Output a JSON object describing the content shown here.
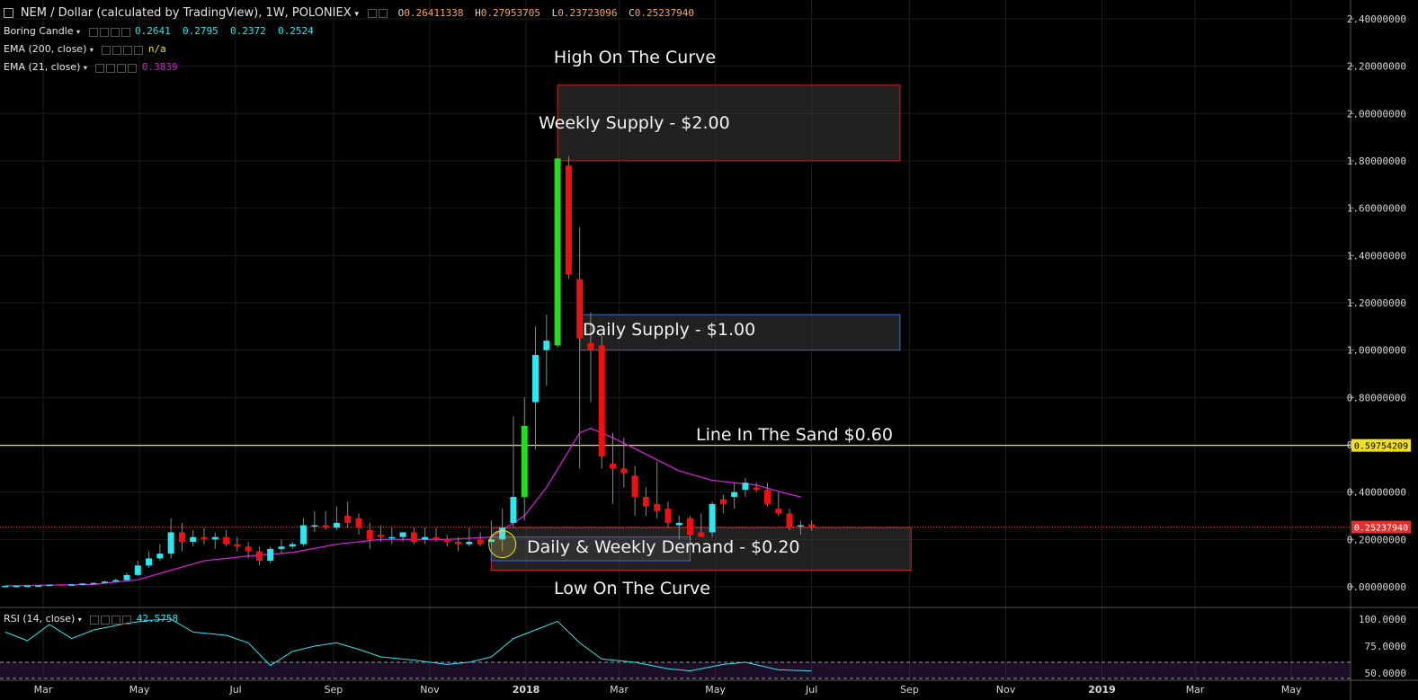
{
  "header": {
    "symbol_title": "NEM / Dollar (calculated by TradingView), 1W, POLONIEX",
    "ohlc": [
      {
        "label": "O",
        "value": "0.26411338"
      },
      {
        "label": "H",
        "value": "0.27953705"
      },
      {
        "label": "L",
        "value": "0.23723096"
      },
      {
        "label": "C",
        "value": "0.25237940"
      }
    ],
    "indicators": [
      {
        "name": "Boring Candle",
        "values": [
          "0.2641",
          "0.2795",
          "0.2372",
          "0.2524"
        ],
        "color": "#2ee6f0"
      },
      {
        "name": "EMA (200, close)",
        "values": [
          "n/a"
        ],
        "color": "#f0e020"
      },
      {
        "name": "EMA (21, close)",
        "values": [
          "0.3839"
        ],
        "color": "#d020d0"
      }
    ]
  },
  "rsi_header": {
    "name": "RSI (14, close)",
    "value": "42.5758",
    "color": "#2ee6f0"
  },
  "colors": {
    "bull_big": "#22dd22",
    "bull_small": "#2ee6f0",
    "bear": "#ee1111",
    "ema": "#d020d0",
    "rsi": "#2ee6f0",
    "level": "#f0e020",
    "price_line": "#e03030",
    "grid": "#1c1c1c"
  },
  "chart_data": {
    "type": "candlestick",
    "time_axis_labels": [
      "Mar",
      "May",
      "Jul",
      "Sep",
      "Nov",
      "2018",
      "Mar",
      "May",
      "Jul",
      "Sep",
      "Nov",
      "2019",
      "Mar",
      "May"
    ],
    "y_ticks": [
      "2.40000000",
      "2.20000000",
      "2.00000000",
      "1.80000000",
      "1.60000000",
      "1.40000000",
      "1.20000000",
      "1.00000000",
      "0.80000000",
      "0.60000000",
      "0.40000000",
      "0.20000000",
      "0.00000000"
    ],
    "ylim": [
      0,
      2.4
    ],
    "candles": [
      {
        "date": "2017-02-05",
        "o": 0.004,
        "h": 0.005,
        "l": 0.003,
        "c": 0.004
      },
      {
        "date": "2017-02-12",
        "o": 0.004,
        "h": 0.005,
        "l": 0.003,
        "c": 0.004
      },
      {
        "date": "2017-02-19",
        "o": 0.004,
        "h": 0.006,
        "l": 0.003,
        "c": 0.005
      },
      {
        "date": "2017-02-26",
        "o": 0.005,
        "h": 0.007,
        "l": 0.004,
        "c": 0.006
      },
      {
        "date": "2017-03-05",
        "o": 0.006,
        "h": 0.01,
        "l": 0.005,
        "c": 0.009
      },
      {
        "date": "2017-03-12",
        "o": 0.009,
        "h": 0.011,
        "l": 0.007,
        "c": 0.008
      },
      {
        "date": "2017-03-19",
        "o": 0.008,
        "h": 0.012,
        "l": 0.007,
        "c": 0.01
      },
      {
        "date": "2017-03-26",
        "o": 0.01,
        "h": 0.016,
        "l": 0.009,
        "c": 0.014
      },
      {
        "date": "2017-04-02",
        "o": 0.014,
        "h": 0.02,
        "l": 0.012,
        "c": 0.016
      },
      {
        "date": "2017-04-09",
        "o": 0.016,
        "h": 0.025,
        "l": 0.014,
        "c": 0.022
      },
      {
        "date": "2017-04-16",
        "o": 0.022,
        "h": 0.035,
        "l": 0.02,
        "c": 0.028
      },
      {
        "date": "2017-04-23",
        "o": 0.028,
        "h": 0.06,
        "l": 0.025,
        "c": 0.05
      },
      {
        "date": "2017-04-30",
        "o": 0.05,
        "h": 0.11,
        "l": 0.045,
        "c": 0.09
      },
      {
        "date": "2017-05-07",
        "o": 0.09,
        "h": 0.15,
        "l": 0.08,
        "c": 0.12
      },
      {
        "date": "2017-05-14",
        "o": 0.12,
        "h": 0.18,
        "l": 0.11,
        "c": 0.14
      },
      {
        "date": "2017-05-21",
        "o": 0.14,
        "h": 0.29,
        "l": 0.12,
        "c": 0.23
      },
      {
        "date": "2017-05-28",
        "o": 0.23,
        "h": 0.27,
        "l": 0.15,
        "c": 0.19
      },
      {
        "date": "2017-06-04",
        "o": 0.19,
        "h": 0.24,
        "l": 0.17,
        "c": 0.21
      },
      {
        "date": "2017-06-11",
        "o": 0.21,
        "h": 0.25,
        "l": 0.18,
        "c": 0.2
      },
      {
        "date": "2017-06-18",
        "o": 0.2,
        "h": 0.23,
        "l": 0.16,
        "c": 0.21
      },
      {
        "date": "2017-06-25",
        "o": 0.21,
        "h": 0.24,
        "l": 0.17,
        "c": 0.18
      },
      {
        "date": "2017-07-02",
        "o": 0.18,
        "h": 0.21,
        "l": 0.15,
        "c": 0.17
      },
      {
        "date": "2017-07-09",
        "o": 0.17,
        "h": 0.19,
        "l": 0.12,
        "c": 0.15
      },
      {
        "date": "2017-07-16",
        "o": 0.15,
        "h": 0.17,
        "l": 0.09,
        "c": 0.11
      },
      {
        "date": "2017-07-23",
        "o": 0.11,
        "h": 0.17,
        "l": 0.1,
        "c": 0.16
      },
      {
        "date": "2017-07-30",
        "o": 0.16,
        "h": 0.2,
        "l": 0.14,
        "c": 0.17
      },
      {
        "date": "2017-08-06",
        "o": 0.17,
        "h": 0.19,
        "l": 0.16,
        "c": 0.18
      },
      {
        "date": "2017-08-13",
        "o": 0.18,
        "h": 0.29,
        "l": 0.17,
        "c": 0.26
      },
      {
        "date": "2017-08-20",
        "o": 0.26,
        "h": 0.32,
        "l": 0.23,
        "c": 0.26
      },
      {
        "date": "2017-08-27",
        "o": 0.26,
        "h": 0.32,
        "l": 0.24,
        "c": 0.25
      },
      {
        "date": "2017-09-03",
        "o": 0.25,
        "h": 0.34,
        "l": 0.24,
        "c": 0.27
      },
      {
        "date": "2017-09-10",
        "o": 0.3,
        "h": 0.36,
        "l": 0.25,
        "c": 0.27
      },
      {
        "date": "2017-09-17",
        "o": 0.29,
        "h": 0.31,
        "l": 0.22,
        "c": 0.25
      },
      {
        "date": "2017-09-24",
        "o": 0.24,
        "h": 0.27,
        "l": 0.16,
        "c": 0.2
      },
      {
        "date": "2017-10-01",
        "o": 0.22,
        "h": 0.26,
        "l": 0.19,
        "c": 0.21
      },
      {
        "date": "2017-10-08",
        "o": 0.21,
        "h": 0.25,
        "l": 0.18,
        "c": 0.21
      },
      {
        "date": "2017-10-15",
        "o": 0.21,
        "h": 0.23,
        "l": 0.19,
        "c": 0.23
      },
      {
        "date": "2017-10-22",
        "o": 0.23,
        "h": 0.25,
        "l": 0.18,
        "c": 0.19
      },
      {
        "date": "2017-10-29",
        "o": 0.2,
        "h": 0.25,
        "l": 0.18,
        "c": 0.21
      },
      {
        "date": "2017-11-05",
        "o": 0.21,
        "h": 0.25,
        "l": 0.19,
        "c": 0.2
      },
      {
        "date": "2017-11-12",
        "o": 0.2,
        "h": 0.22,
        "l": 0.17,
        "c": 0.19
      },
      {
        "date": "2017-11-19",
        "o": 0.19,
        "h": 0.21,
        "l": 0.15,
        "c": 0.18
      },
      {
        "date": "2017-11-26",
        "o": 0.18,
        "h": 0.25,
        "l": 0.17,
        "c": 0.19
      },
      {
        "date": "2017-12-03",
        "o": 0.2,
        "h": 0.23,
        "l": 0.17,
        "c": 0.18
      },
      {
        "date": "2017-12-10",
        "o": 0.19,
        "h": 0.28,
        "l": 0.18,
        "c": 0.2
      },
      {
        "date": "2017-12-17",
        "o": 0.2,
        "h": 0.33,
        "l": 0.15,
        "c": 0.25
      },
      {
        "date": "2017-12-24",
        "o": 0.27,
        "h": 0.72,
        "l": 0.25,
        "c": 0.38
      },
      {
        "date": "2017-12-31",
        "o": 0.38,
        "h": 0.8,
        "l": 0.28,
        "c": 0.68
      },
      {
        "date": "2018-01-07",
        "o": 0.78,
        "h": 1.1,
        "l": 0.58,
        "c": 0.98
      },
      {
        "date": "2018-01-14",
        "o": 1.0,
        "h": 1.15,
        "l": 0.85,
        "c": 1.04
      },
      {
        "date": "2018-01-21",
        "o": 1.02,
        "h": 1.81,
        "l": 1.01,
        "c": 1.81
      },
      {
        "date": "2018-01-28",
        "o": 1.78,
        "h": 1.82,
        "l": 1.3,
        "c": 1.32
      },
      {
        "date": "2018-02-04",
        "o": 1.3,
        "h": 1.52,
        "l": 0.5,
        "c": 1.05
      },
      {
        "date": "2018-02-11",
        "o": 1.03,
        "h": 1.16,
        "l": 0.78,
        "c": 1.0
      },
      {
        "date": "2018-02-18",
        "o": 1.02,
        "h": 1.06,
        "l": 0.5,
        "c": 0.55
      },
      {
        "date": "2018-02-25",
        "o": 0.52,
        "h": 0.65,
        "l": 0.35,
        "c": 0.5
      },
      {
        "date": "2018-03-04",
        "o": 0.5,
        "h": 0.63,
        "l": 0.42,
        "c": 0.48
      },
      {
        "date": "2018-03-11",
        "o": 0.47,
        "h": 0.51,
        "l": 0.3,
        "c": 0.38
      },
      {
        "date": "2018-03-18",
        "o": 0.38,
        "h": 0.42,
        "l": 0.3,
        "c": 0.34
      },
      {
        "date": "2018-03-25",
        "o": 0.35,
        "h": 0.53,
        "l": 0.29,
        "c": 0.32
      },
      {
        "date": "2018-04-01",
        "o": 0.33,
        "h": 0.36,
        "l": 0.25,
        "c": 0.27
      },
      {
        "date": "2018-04-08",
        "o": 0.26,
        "h": 0.3,
        "l": 0.2,
        "c": 0.27
      },
      {
        "date": "2018-04-15",
        "o": 0.29,
        "h": 0.3,
        "l": 0.18,
        "c": 0.22
      },
      {
        "date": "2018-04-22",
        "o": 0.23,
        "h": 0.31,
        "l": 0.21,
        "c": 0.21
      },
      {
        "date": "2018-04-29",
        "o": 0.23,
        "h": 0.36,
        "l": 0.21,
        "c": 0.35
      },
      {
        "date": "2018-05-06",
        "o": 0.37,
        "h": 0.39,
        "l": 0.31,
        "c": 0.35
      },
      {
        "date": "2018-05-13",
        "o": 0.38,
        "h": 0.44,
        "l": 0.33,
        "c": 0.4
      },
      {
        "date": "2018-05-20",
        "o": 0.41,
        "h": 0.46,
        "l": 0.38,
        "c": 0.44
      },
      {
        "date": "2018-05-27",
        "o": 0.42,
        "h": 0.44,
        "l": 0.4,
        "c": 0.41
      },
      {
        "date": "2018-06-03",
        "o": 0.41,
        "h": 0.44,
        "l": 0.34,
        "c": 0.35
      },
      {
        "date": "2018-06-10",
        "o": 0.33,
        "h": 0.4,
        "l": 0.3,
        "c": 0.31
      },
      {
        "date": "2018-06-17",
        "o": 0.31,
        "h": 0.33,
        "l": 0.24,
        "c": 0.25
      },
      {
        "date": "2018-06-24",
        "o": 0.26,
        "h": 0.28,
        "l": 0.22,
        "c": 0.26
      },
      {
        "date": "2018-07-01",
        "o": 0.264,
        "h": 0.28,
        "l": 0.237,
        "c": 0.252
      }
    ],
    "ema21": [
      {
        "date": "2017-02-05",
        "v": 0.004
      },
      {
        "date": "2017-04-02",
        "v": 0.01
      },
      {
        "date": "2017-04-30",
        "v": 0.03
      },
      {
        "date": "2017-05-21",
        "v": 0.07
      },
      {
        "date": "2017-06-11",
        "v": 0.11
      },
      {
        "date": "2017-07-09",
        "v": 0.13
      },
      {
        "date": "2017-08-06",
        "v": 0.145
      },
      {
        "date": "2017-09-03",
        "v": 0.18
      },
      {
        "date": "2017-10-01",
        "v": 0.2
      },
      {
        "date": "2017-11-12",
        "v": 0.2
      },
      {
        "date": "2017-12-10",
        "v": 0.21
      },
      {
        "date": "2017-12-31",
        "v": 0.3
      },
      {
        "date": "2018-01-14",
        "v": 0.42
      },
      {
        "date": "2018-02-04",
        "v": 0.65
      },
      {
        "date": "2018-02-11",
        "v": 0.67
      },
      {
        "date": "2018-02-25",
        "v": 0.63
      },
      {
        "date": "2018-03-18",
        "v": 0.56
      },
      {
        "date": "2018-04-08",
        "v": 0.49
      },
      {
        "date": "2018-04-29",
        "v": 0.45
      },
      {
        "date": "2018-05-27",
        "v": 0.43
      },
      {
        "date": "2018-06-17",
        "v": 0.39
      },
      {
        "date": "2018-06-24",
        "v": 0.38
      }
    ],
    "rsi": {
      "ylim": [
        0,
        100
      ],
      "y_ticks": [
        "100.0000",
        "75.0000",
        "50.0000"
      ],
      "bands": [
        70,
        30
      ],
      "points": [
        {
          "date": "2017-02-05",
          "v": 88
        },
        {
          "date": "2017-02-19",
          "v": 80
        },
        {
          "date": "2017-03-05",
          "v": 95
        },
        {
          "date": "2017-03-19",
          "v": 82
        },
        {
          "date": "2017-04-02",
          "v": 90
        },
        {
          "date": "2017-04-23",
          "v": 96
        },
        {
          "date": "2017-05-07",
          "v": 99
        },
        {
          "date": "2017-05-21",
          "v": 100
        },
        {
          "date": "2017-06-04",
          "v": 88
        },
        {
          "date": "2017-06-25",
          "v": 85
        },
        {
          "date": "2017-07-09",
          "v": 78
        },
        {
          "date": "2017-07-23",
          "v": 57
        },
        {
          "date": "2017-08-06",
          "v": 70
        },
        {
          "date": "2017-08-20",
          "v": 75
        },
        {
          "date": "2017-09-03",
          "v": 78
        },
        {
          "date": "2017-09-17",
          "v": 72
        },
        {
          "date": "2017-10-01",
          "v": 65
        },
        {
          "date": "2017-10-22",
          "v": 62
        },
        {
          "date": "2017-11-12",
          "v": 58
        },
        {
          "date": "2017-11-26",
          "v": 60
        },
        {
          "date": "2017-12-10",
          "v": 65
        },
        {
          "date": "2017-12-24",
          "v": 82
        },
        {
          "date": "2018-01-07",
          "v": 90
        },
        {
          "date": "2018-01-21",
          "v": 98
        },
        {
          "date": "2018-02-04",
          "v": 78
        },
        {
          "date": "2018-02-18",
          "v": 63
        },
        {
          "date": "2018-03-11",
          "v": 60
        },
        {
          "date": "2018-04-01",
          "v": 54
        },
        {
          "date": "2018-04-15",
          "v": 52
        },
        {
          "date": "2018-05-06",
          "v": 58
        },
        {
          "date": "2018-05-20",
          "v": 60
        },
        {
          "date": "2018-06-10",
          "v": 53
        },
        {
          "date": "2018-07-01",
          "v": 52
        }
      ]
    },
    "annotations": {
      "top_text": "High On The Curve",
      "bottom_text": "Low On The Curve",
      "zones": [
        {
          "label": "Weekly Supply - $2.00",
          "y_top": 2.12,
          "y_bottom": 1.8,
          "x_start": "2018-01-21",
          "x_end": "2018-08-26",
          "border": "#cc2222"
        },
        {
          "label": "Daily Supply - $1.00",
          "y_top": 1.15,
          "y_bottom": 1.0,
          "x_start": "2018-02-04",
          "x_end": "2018-08-26",
          "border": "#3a6fd0"
        },
        {
          "label": "Daily & Weekly Demand - $0.20",
          "y_top": 0.25,
          "y_bottom": 0.07,
          "x_start": "2017-12-10",
          "x_end": "2018-09-02",
          "border": "#cc2222"
        }
      ],
      "inner_zone": {
        "y_top": 0.21,
        "y_bottom": 0.11,
        "x_start": "2017-12-10",
        "x_end": "2018-04-15",
        "border": "#3a6fd0"
      },
      "horizontal_line": {
        "label": "Line In The Sand $0.60",
        "value": 0.5975,
        "badge": "0.59754209"
      },
      "current_price": {
        "value": 0.2524,
        "badge": "0.25237940"
      },
      "circle_marker": {
        "date": "2017-12-17",
        "value": 0.18
      }
    }
  }
}
